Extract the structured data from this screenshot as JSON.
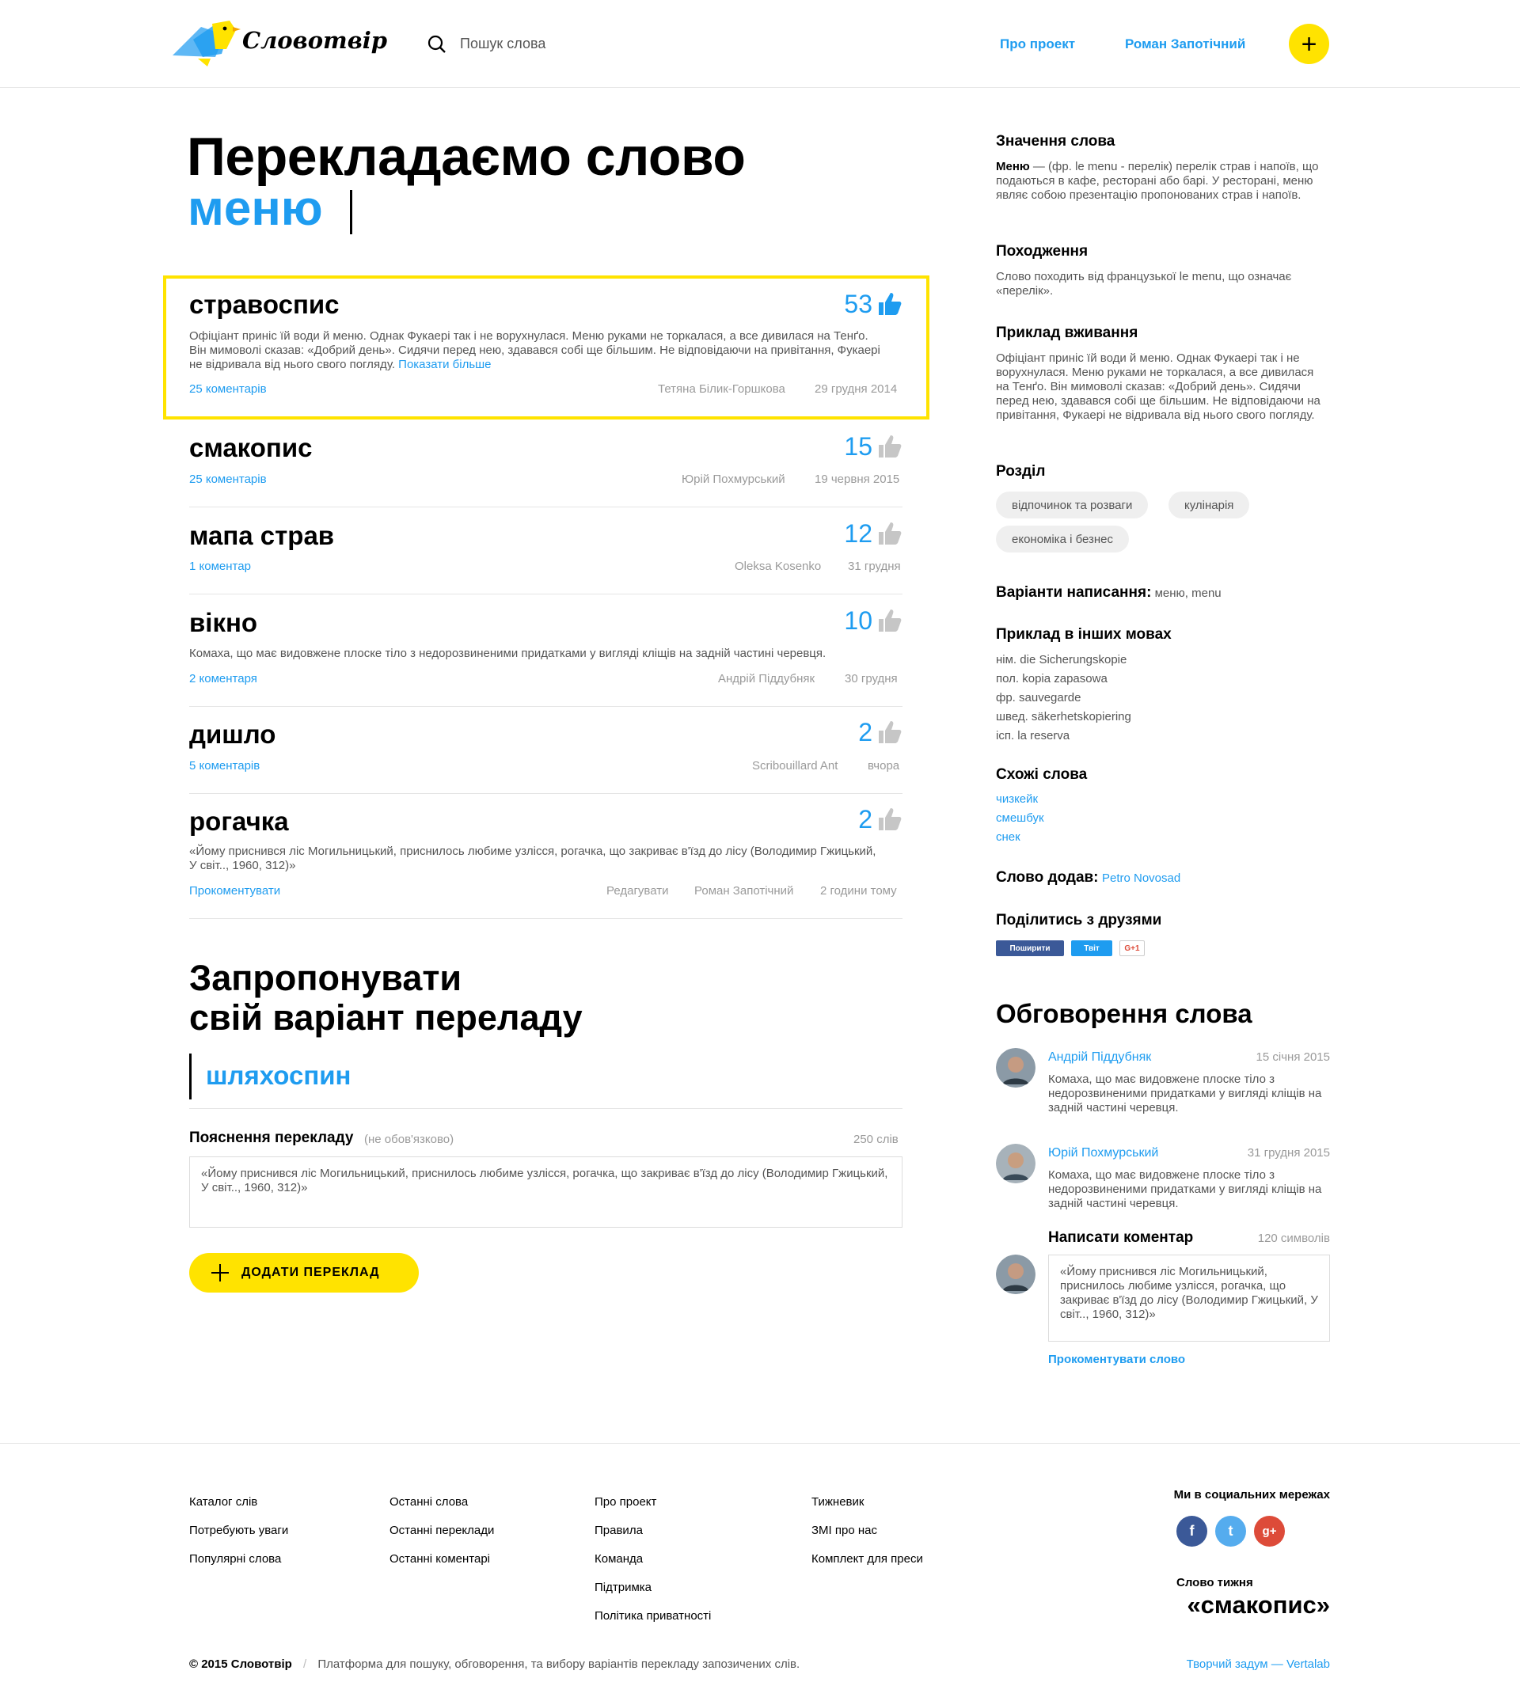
{
  "header": {
    "logo_text": "Словотвір",
    "search_placeholder": "Пошук слова",
    "nav": [
      "Про проект",
      "Роман Запотічний"
    ],
    "add_button": "+"
  },
  "page": {
    "title_line": "Перекладаємо слово",
    "word": "меню"
  },
  "translations": [
    {
      "word": "стравоспис",
      "votes": "53",
      "liked": true,
      "desc": "Офіціант приніс їй води й меню. Однак Фукаері так і не ворухнулася. Меню руками не торкалася, а все дивилася на Тенґо. Він мимоволі сказав: «Добрий день». Сидячи перед нею, здавався собі ще більшим. Не відповідаючи на привітання, Фукаері не відривала від нього свого погляду.",
      "more": "Показати більше",
      "comments": "25 коментарів",
      "edit": "",
      "author": "Тетяна Білик-Горшкова",
      "date": "29 грудня 2014"
    },
    {
      "word": "смакопис",
      "votes": "15",
      "liked": false,
      "desc": "",
      "more": "",
      "comments": "25 коментарів",
      "edit": "",
      "author": "Юрій Похмурський",
      "date": "19 червня 2015"
    },
    {
      "word": "мапа страв",
      "votes": "12",
      "liked": false,
      "desc": "",
      "more": "",
      "comments": "1 коментар",
      "edit": "",
      "author": "Oleksa Kosenko",
      "date": "31 грудня"
    },
    {
      "word": "вікно",
      "votes": "10",
      "liked": false,
      "desc": "Комаха, що має видовжене плоске тіло з недорозвиненими придатками у вигляді кліщів на задній частині черевця.",
      "more": "",
      "comments": "2 коментаря",
      "edit": "",
      "author": "Андрій Піддубняк",
      "date": "30 грудня"
    },
    {
      "word": "дишло",
      "votes": "2",
      "liked": false,
      "desc": "",
      "more": "",
      "comments": "5 коментарів",
      "edit": "",
      "author": "Scribouillard Ant",
      "date": "вчора"
    },
    {
      "word": "рогачка",
      "votes": "2",
      "liked": false,
      "desc": "«Йому приснився ліс Могильницький, приснилось любиме узлісся, рогачка, що закриває в'їзд до лісу (Володимир Гжицький, У світ.., 1960, 312)»",
      "more": "",
      "comments": "Прокоментувати",
      "edit": "Редагувати",
      "author": "Роман Запотічний",
      "date": "2 години тому"
    }
  ],
  "propose": {
    "title1": "Запропонувати",
    "title2": "свій варіант переладу",
    "word": "шляхоспин",
    "explain_label": "Пояснення перекладу",
    "optional": "(не обов'язково)",
    "limit": "250 слів",
    "textarea": "«Йому приснився ліс Могильницький, приснилось любиме узлісся, рогачка, що закриває в'їзд до лісу (Володимир Гжицький, У світ.., 1960, 312)»",
    "button": "ДОДАТИ ПЕРЕКЛАД"
  },
  "sidebar": {
    "meaning_h": "Значення слова",
    "meaning_bold": "Меню",
    "meaning": " — (фр. le menu - перелік) перелік страв і напоїв, що подаються в кафе, ресторані або барі. У ресторані, меню являє собою презентацію пропонованих страв і напоїв.",
    "origin_h": "Походження",
    "origin": "Слово походить від французької le menu, що означає «перелік».",
    "example_h": "Приклад вживання",
    "example": "Офіціант приніс їй води й меню. Однак Фукаері так і не ворухнулася. Меню руками не торкалася, а все дивилася на Тенґо. Він мимоволі сказав: «Добрий день». Сидячи перед нею, здавався собі ще більшим. Не відповідаючи на привітання, Фукаері не відривала від нього свого погляду.",
    "section_h": "Розділ",
    "tags": [
      "відпочинок та розваги",
      "кулінарія",
      "економіка і безнес"
    ],
    "spelling_h": "Варіанти написання:",
    "spelling": " меню, menu",
    "langs_h": "Приклад в інших мовах",
    "langs": [
      "нім. die Sicherungskopie",
      "пол. kopia zapasowa",
      "фр. sauvegarde",
      "швед. säkerhetskopiering",
      "ісп. la reserva"
    ],
    "similar_h": "Схожі слова",
    "similar": [
      "чизкейк",
      "смешбук",
      "снек"
    ],
    "added_h": "Слово додав:",
    "added_by": "Petro Novosad",
    "share_h": "Поділитись з друзями",
    "share": [
      "Поширити",
      "Твіт",
      "G+1"
    ]
  },
  "discussion": {
    "title": "Обговорення слова",
    "comments": [
      {
        "name": "Андрій Піддубняк",
        "date": "15 січня 2015",
        "text": "Комаха, що має видовжене плоске тіло з недорозвиненими придатками у вигляді кліщів на задній частині черевця."
      },
      {
        "name": "Юрій Похмурський",
        "date": "31 грудня 2015",
        "text": "Комаха, що має видовжене плоске тіло з недорозвиненими придатками у вигляді кліщів на задній частині черевця."
      }
    ],
    "write_h": "Написати коментар",
    "write_limit": "120 символів",
    "write_text": "«Йому приснився ліс Могильницький, приснилось любиме узлісся, рогачка, що закриває в'їзд до лісу (Володимир Гжицький, У світ.., 1960, 312)»",
    "submit": "Прокоментувати слово"
  },
  "footer": {
    "col1": [
      "Каталог слів",
      "Потребують уваги",
      "Популярні слова"
    ],
    "col2": [
      "Останні слова",
      "Останні переклади",
      "Останні коментарі"
    ],
    "col3": [
      "Про проект",
      "Правила",
      "Команда",
      "Підтримка",
      "Політика приватності"
    ],
    "col4": [
      "Тижневик",
      "ЗМІ про нас",
      "Комплект для преси"
    ],
    "social_h": "Ми в социальних мережах",
    "social": [
      "f",
      "t",
      "g+"
    ],
    "week_h": "Слово тижня",
    "week_word": "«смакопис»",
    "copyright": "© 2015 Словотвір",
    "tagline": "Платформа для пошуку, обговорення, та вибору варіантів перекладу запозичених слів.",
    "credit": "Творчий задум — Vertalab"
  },
  "colors": {
    "accent": "#1e9cf0",
    "yellow": "#ffe300",
    "facebook": "#3b5998",
    "twitter": "#55acee",
    "gplus": "#dd4b39"
  }
}
